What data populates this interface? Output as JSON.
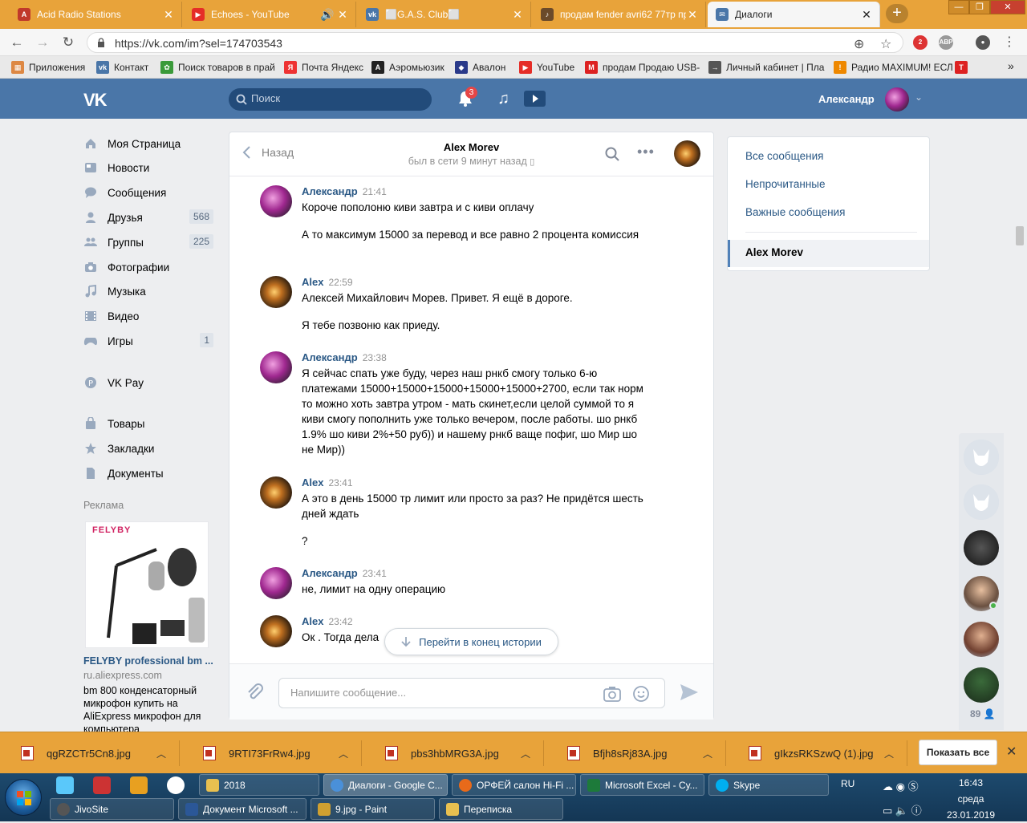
{
  "browser": {
    "tabs": [
      {
        "title": "Acid Radio Stations",
        "color": "#c0392b"
      },
      {
        "title": "Echoes - YouTube",
        "color": "#e52d27"
      },
      {
        "title": "⬜G.A.S. Club⬜",
        "color": "#4a76a8"
      },
      {
        "title": "продам fender avri62 77тр про",
        "color": "#6b4a2a"
      },
      {
        "title": "Диалоги",
        "color": "#4a76a8"
      }
    ],
    "url": "https://vk.com/im?sel=174703543",
    "ext_badge": "2",
    "ext_label": "АВР"
  },
  "bookmarks": [
    {
      "label": "Приложения",
      "color": "#d84"
    },
    {
      "label": "Контакт",
      "color": "#4a76a8"
    },
    {
      "label": "Поиск товаров в прай",
      "color": "#3a9a3a"
    },
    {
      "label": "Почта Яндекс",
      "color": "#e33"
    },
    {
      "label": "Аэромьюзик",
      "color": "#222"
    },
    {
      "label": "Авалон",
      "color": "#2a3a8a"
    },
    {
      "label": "YouTube",
      "color": "#e52d27"
    },
    {
      "label": "продам Продаю USB-",
      "color": "#d22"
    },
    {
      "label": "Личный кабинет | Пла",
      "color": "#555"
    },
    {
      "label": "Радио MAXIMUM! ЕСЛ",
      "color": "#e80"
    }
  ],
  "vk": {
    "logo": "VK",
    "search_placeholder": "Поиск",
    "notif_count": "3",
    "user": "Александр"
  },
  "nav": [
    {
      "label": "Моя Страница",
      "icon": "home-icon",
      "badge": ""
    },
    {
      "label": "Новости",
      "icon": "news-icon",
      "badge": ""
    },
    {
      "label": "Сообщения",
      "icon": "messages-icon",
      "badge": ""
    },
    {
      "label": "Друзья",
      "icon": "friends-icon",
      "badge": "568"
    },
    {
      "label": "Группы",
      "icon": "groups-icon",
      "badge": "225"
    },
    {
      "label": "Фотографии",
      "icon": "camera-icon",
      "badge": ""
    },
    {
      "label": "Музыка",
      "icon": "music-icon",
      "badge": ""
    },
    {
      "label": "Видео",
      "icon": "video-icon",
      "badge": ""
    },
    {
      "label": "Игры",
      "icon": "gamepad-icon",
      "badge": "1"
    },
    {
      "label": "VK Pay",
      "icon": "vkpay-icon",
      "badge": ""
    },
    {
      "label": "Товары",
      "icon": "bag-icon",
      "badge": ""
    },
    {
      "label": "Закладки",
      "icon": "star-icon",
      "badge": ""
    },
    {
      "label": "Документы",
      "icon": "document-icon",
      "badge": ""
    }
  ],
  "ad": {
    "label": "Реклама",
    "brand": "FELYBY",
    "title": "FELYBY professional bm ...",
    "site": "ru.aliexpress.com",
    "desc": "bm 800 конденсаторный микрофон купить на AliExpress микрофон для компьютера"
  },
  "chat": {
    "back": "Назад",
    "peer": "Alex Morev",
    "status": "был в сети 9 минут назад",
    "messages": [
      {
        "author": "Александр",
        "time": "21:41",
        "avatar": "g",
        "lines": [
          "Короче пополоню киви завтра и с киви оплачу",
          "А то максимум 15000 за перевод и все равно 2 процента комиссия"
        ]
      },
      {
        "author": "Alex",
        "time": "22:59",
        "avatar": "a",
        "lines": [
          "Алексей Михайлович Морев. Привет. Я ещё в дороге.",
          "Я тебе позвоню как приеду."
        ]
      },
      {
        "author": "Александр",
        "time": "23:38",
        "avatar": "g",
        "lines": [
          "Я сейчас спать уже буду, через наш рнкб смогу только 6-ю платежами 15000+15000+15000+15000+15000+2700, если так норм то можно хоть завтра утром - мать скинет,если целой суммой то я киви смогу пополнить уже только вечером, после работы. шо рнкб 1.9% шо киви 2%+50 руб)) и нашему рнкб ваще пофиг, шо Мир шо не Мир))"
        ]
      },
      {
        "author": "Alex",
        "time": "23:41",
        "avatar": "a",
        "lines": [
          "А это в день 15000 тр лимит или просто за раз? Не придётся шесть дней ждать",
          "?"
        ]
      },
      {
        "author": "Александр",
        "time": "23:41",
        "avatar": "g",
        "lines": [
          "не, лимит на одну операцию"
        ]
      },
      {
        "author": "Alex",
        "time": "23:42",
        "avatar": "a",
        "lines": [
          "Ок . Тогда дела"
        ]
      }
    ],
    "jump": "Перейти в конец истории",
    "input_placeholder": "Напишите сообщение..."
  },
  "filters": {
    "items": [
      "Все сообщения",
      "Непрочитанные",
      "Важные сообщения"
    ],
    "active": "Alex Morev"
  },
  "friends_count": "89",
  "downloads": {
    "files": [
      "qgRZCTr5Cn8.jpg",
      "9RTI73FrRw4.jpg",
      "pbs3hbMRG3A.jpg",
      "Bfjh8sRj83A.jpg",
      "gIkzsRKSzwQ (1).jpg"
    ],
    "show_all": "Показать все"
  },
  "taskbar": {
    "row1": [
      {
        "label": "2018",
        "color": "#e8c050"
      },
      {
        "label": "Диалоги - Google C...",
        "color": "#4a90d9"
      },
      {
        "label": "ОРФЕЙ салон Hi-Fi ...",
        "color": "#e86a1a"
      },
      {
        "label": "Microsoft Excel - Су...",
        "color": "#1d7a3a"
      },
      {
        "label": "Skype",
        "color": "#00aff0"
      }
    ],
    "row2": [
      {
        "label": "JivoSite",
        "color": "#555"
      },
      {
        "label": "Документ Microsoft ...",
        "color": "#2b5797"
      },
      {
        "label": "9.jpg - Paint",
        "color": "#d0a030"
      },
      {
        "label": "Переписка",
        "color": "#e8c050"
      }
    ],
    "lang": "RU",
    "time": "16:43",
    "day": "среда",
    "date": "23.01.2019"
  }
}
